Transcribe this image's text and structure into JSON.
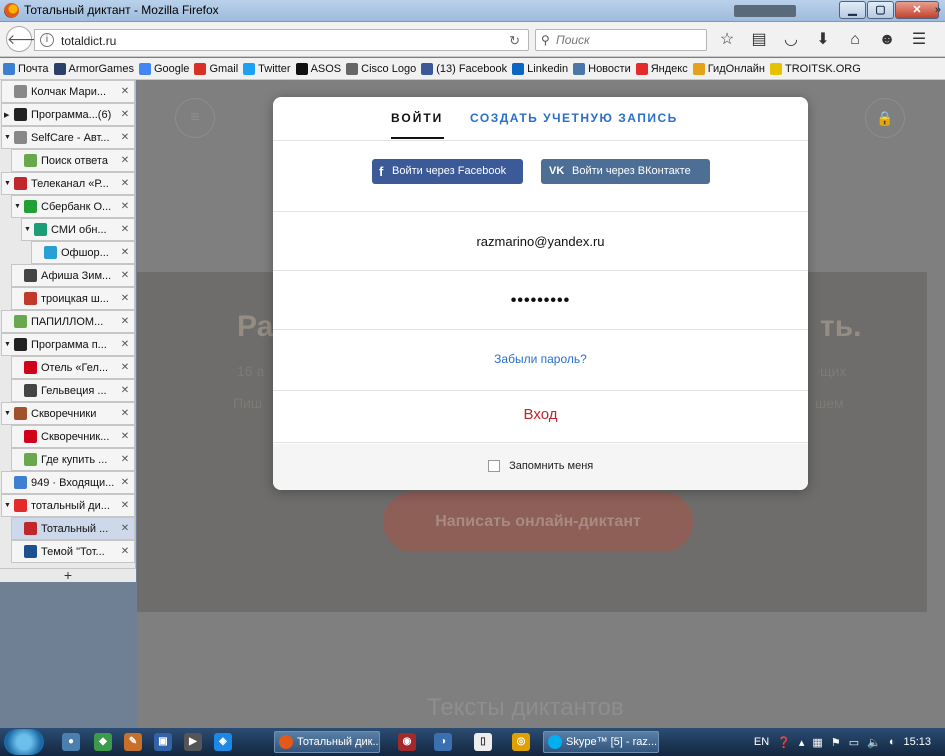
{
  "window": {
    "title": "Тотальный диктант - Mozilla Firefox"
  },
  "nav": {
    "url": "totaldict.ru",
    "search_placeholder": "Поиск"
  },
  "bookmarks": [
    {
      "label": "Почта",
      "icon": "mail-icon",
      "color": "#3f7fd0"
    },
    {
      "label": "ArmorGames",
      "icon": "shield-icon",
      "color": "#2b3f6a"
    },
    {
      "label": "Google",
      "icon": "google-icon",
      "color": "#4285f4"
    },
    {
      "label": "Gmail",
      "icon": "gmail-icon",
      "color": "#d93025"
    },
    {
      "label": "Twitter",
      "icon": "twitter-icon",
      "color": "#1da1f2"
    },
    {
      "label": "ASOS",
      "icon": "asos-icon",
      "color": "#111111"
    },
    {
      "label": "Cisco Logo",
      "icon": "globe-icon",
      "color": "#666666"
    },
    {
      "label": "(13) Facebook",
      "icon": "facebook-icon",
      "color": "#3b5998"
    },
    {
      "label": "Linkedin",
      "icon": "linkedin-icon",
      "color": "#0a66c2"
    },
    {
      "label": "Новости",
      "icon": "vk-icon",
      "color": "#4a76a8"
    },
    {
      "label": "Яндекс",
      "icon": "yandex-icon",
      "color": "#e42b2b"
    },
    {
      "label": "ГидОнлайн",
      "icon": "gidonline-icon",
      "color": "#e5a11b"
    },
    {
      "label": "TROITSK.ORG",
      "icon": "troitsk-icon",
      "color": "#e6c200"
    }
  ],
  "bookmarks_more": "»",
  "tabs": [
    {
      "label": "Колчак Мари...",
      "indent": 0,
      "twisty": "",
      "icon": "globe-icon",
      "color": "#888888"
    },
    {
      "label": "Программа...(6)",
      "indent": 0,
      "twisty": "▶",
      "icon": "tv-icon",
      "color": "#222222"
    },
    {
      "label": "SelfCare - Авт...",
      "indent": 0,
      "twisty": "▼",
      "icon": "globe-icon",
      "color": "#888888"
    },
    {
      "label": "Поиск ответа",
      "indent": 1,
      "twisty": "",
      "icon": "mailru-icon",
      "color": "#6aa84f"
    },
    {
      "label": "Телеканал «Р...",
      "indent": 0,
      "twisty": "▼",
      "icon": "k-icon",
      "color": "#c0262b"
    },
    {
      "label": "Сбербанк О...",
      "indent": 1,
      "twisty": "▼",
      "icon": "sberbank-icon",
      "color": "#21a038"
    },
    {
      "label": "СМИ обн...",
      "indent": 2,
      "twisty": "▼",
      "icon": "flag-icon",
      "color": "#1b9e77"
    },
    {
      "label": "Офшор...",
      "indent": 3,
      "twisty": "",
      "icon": "h-icon",
      "color": "#2a9fd6"
    },
    {
      "label": "Афиша Зим...",
      "indent": 1,
      "twisty": "",
      "icon": "photo-icon",
      "color": "#444444"
    },
    {
      "label": "троицкая ш...",
      "indent": 1,
      "twisty": "",
      "icon": "image-icon",
      "color": "#c0392b"
    },
    {
      "label": "ПАПИЛЛОМ...",
      "indent": 0,
      "twisty": "",
      "icon": "leaf-icon",
      "color": "#6aa84f"
    },
    {
      "label": "Программа п...",
      "indent": 0,
      "twisty": "▼",
      "icon": "tv-icon",
      "color": "#222222"
    },
    {
      "label": "Отель «Гел...",
      "indent": 1,
      "twisty": "",
      "icon": "v-icon",
      "color": "#d0021b"
    },
    {
      "label": "Гельвеция ...",
      "indent": 1,
      "twisty": "",
      "icon": "wikipedia-icon",
      "color": "#444444"
    },
    {
      "label": "Скворечники",
      "indent": 0,
      "twisty": "▼",
      "icon": "birdhouse-icon",
      "color": "#a0522d"
    },
    {
      "label": "Скворечник...",
      "indent": 1,
      "twisty": "",
      "icon": "n-icon",
      "color": "#d0021b"
    },
    {
      "label": "Где купить ...",
      "indent": 1,
      "twisty": "",
      "icon": "pin-icon",
      "color": "#6aa84f"
    },
    {
      "label": "949 · Входящи...",
      "indent": 0,
      "twisty": "",
      "icon": "mail-icon",
      "color": "#3f7fd0"
    },
    {
      "label": "тотальный ди...",
      "indent": 0,
      "twisty": "▼",
      "icon": "yandex-icon",
      "color": "#e42b2b"
    },
    {
      "label": "Тотальный ...",
      "indent": 1,
      "twisty": "",
      "icon": "totaldict-icon",
      "color": "#c0262b",
      "active": true
    },
    {
      "label": "Темой \"Тот...",
      "indent": 1,
      "twisty": "",
      "icon": "circle-icon",
      "color": "#1e4f8f"
    }
  ],
  "new_tab_label": "+",
  "page": {
    "hero_title_start": "Ра",
    "hero_title_end": "ть.",
    "hero_sub1_start": "16 а",
    "hero_sub1_end": "щих",
    "hero_sub2_start": "Пиш",
    "hero_sub2_end": "шем",
    "write_button": "Написать онлайн-диктант",
    "texts_title": "Тексты диктантов"
  },
  "modal": {
    "tab_login": "ВОЙТИ",
    "tab_register": "СОЗДАТЬ УЧЕТНУЮ ЗАПИСЬ",
    "facebook_button": "Войти через Facebook",
    "vk_button": "Войти через ВКонтакте",
    "email_value": "razmarino@yandex.ru",
    "password_dots": "•••••••••",
    "forgot_link": "Забыли пароль?",
    "submit_button": "Вход",
    "remember_label": "Запомнить меня",
    "remember_checked": false
  },
  "taskbar": {
    "tasks": [
      {
        "label": "Тотальный дик...",
        "icon": "firefox-icon",
        "color": "#e2591a"
      },
      {
        "label": "Skype™ [5] - raz...",
        "icon": "skype-icon",
        "color": "#00aff0"
      }
    ],
    "lang": "EN",
    "time": "15:13"
  }
}
